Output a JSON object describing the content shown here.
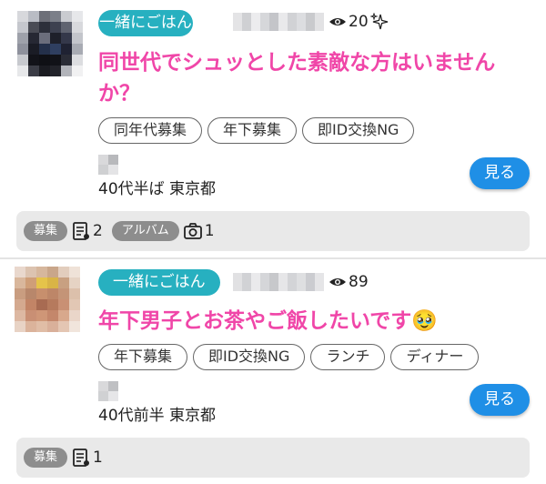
{
  "posts": [
    {
      "category": "一緒にごはん",
      "views": "20",
      "title": "同世代でシュッとした素敵な方はいませんか？",
      "tags": [
        "同年代募集",
        "年下募集",
        "即ID交換NG"
      ],
      "location": "40代半ば 東京都",
      "view_button": "見る",
      "footer": {
        "recruit_label": "募集",
        "recruit_count": "2",
        "album_label": "アルバム",
        "photo_count": "1"
      },
      "views_icon": "eye-icon",
      "sparkle_icon": "sparkle-icon"
    },
    {
      "category": "一緒にごはん",
      "views": "89",
      "title": "年下男子とお茶やご飯したいです🥹",
      "tags": [
        "年下募集",
        "即ID交換NG",
        "ランチ",
        "ディナー"
      ],
      "location": "40代前半 東京都",
      "view_button": "見る",
      "footer": {
        "recruit_label": "募集",
        "recruit_count": "1"
      },
      "views_icon": "eye-icon"
    }
  ],
  "colors": {
    "category_pill": "#27b0c0",
    "title_pink": "#f046a8",
    "view_button": "#1f8fe6",
    "footer_bg": "#e9e9e9",
    "footer_badge": "#8d8d8d"
  }
}
